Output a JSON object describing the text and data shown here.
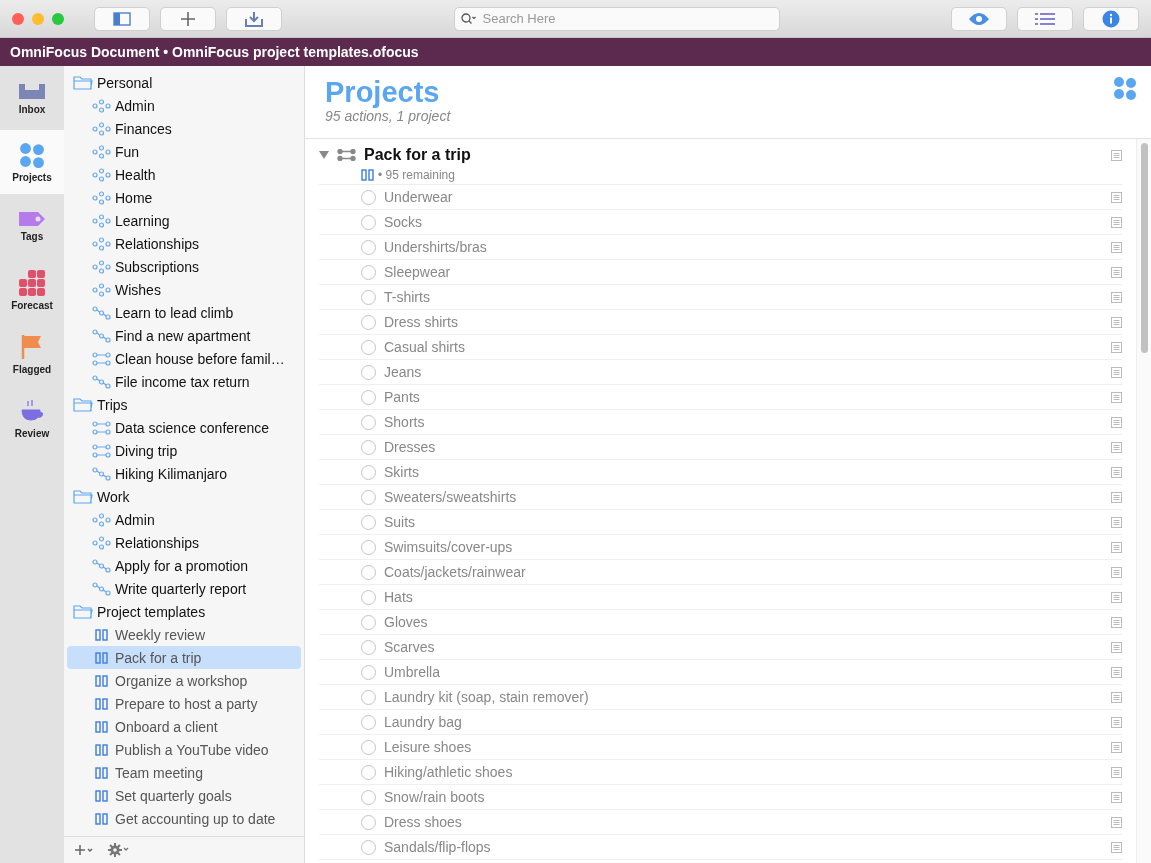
{
  "toolbar": {
    "search": {
      "placeholder": "Search Here"
    }
  },
  "title_bar": {
    "title": "OmniFocus Document • OmniFocus project templates.ofocus"
  },
  "perspectives": [
    {
      "label": "Inbox",
      "kind": "inbox",
      "selected": false
    },
    {
      "label": "Projects",
      "kind": "projects",
      "selected": true
    },
    {
      "label": "Tags",
      "kind": "tags",
      "selected": false
    },
    {
      "label": "Forecast",
      "kind": "forecast",
      "selected": false
    },
    {
      "label": "Flagged",
      "kind": "flagged",
      "selected": false
    },
    {
      "label": "Review",
      "kind": "review",
      "selected": false
    }
  ],
  "sidebar": {
    "folders": [
      {
        "label": "Personal",
        "children": [
          {
            "label": "Admin",
            "kind": "single",
            "selected": false
          },
          {
            "label": "Finances",
            "kind": "single",
            "selected": false
          },
          {
            "label": "Fun",
            "kind": "single",
            "selected": false
          },
          {
            "label": "Health",
            "kind": "single",
            "selected": false
          },
          {
            "label": "Home",
            "kind": "single",
            "selected": false
          },
          {
            "label": "Learning",
            "kind": "single",
            "selected": false
          },
          {
            "label": "Relationships",
            "kind": "single",
            "selected": false
          },
          {
            "label": "Subscriptions",
            "kind": "single",
            "selected": false
          },
          {
            "label": "Wishes",
            "kind": "single",
            "selected": false
          },
          {
            "label": "Learn to lead climb",
            "kind": "sequential",
            "selected": false
          },
          {
            "label": "Find a new apartment",
            "kind": "sequential",
            "selected": false
          },
          {
            "label": "Clean house before famil…",
            "kind": "parallel",
            "selected": false
          },
          {
            "label": "File income tax return",
            "kind": "sequential",
            "selected": false
          }
        ]
      },
      {
        "label": "Trips",
        "children": [
          {
            "label": "Data science conference",
            "kind": "parallel",
            "selected": false
          },
          {
            "label": "Diving trip",
            "kind": "parallel",
            "selected": false
          },
          {
            "label": "Hiking Kilimanjaro",
            "kind": "sequential",
            "selected": false
          }
        ]
      },
      {
        "label": "Work",
        "children": [
          {
            "label": "Admin",
            "kind": "single",
            "selected": false
          },
          {
            "label": "Relationships",
            "kind": "single",
            "selected": false
          },
          {
            "label": "Apply for a promotion",
            "kind": "sequential",
            "selected": false
          },
          {
            "label": "Write quarterly report",
            "kind": "sequential",
            "selected": false
          }
        ]
      },
      {
        "label": "Project templates",
        "children": [
          {
            "label": "Weekly review",
            "kind": "on_hold",
            "selected": false
          },
          {
            "label": "Pack for a trip",
            "kind": "on_hold",
            "selected": true
          },
          {
            "label": "Organize a workshop",
            "kind": "on_hold",
            "selected": false
          },
          {
            "label": "Prepare to host a party",
            "kind": "on_hold",
            "selected": false
          },
          {
            "label": "Onboard a client",
            "kind": "on_hold",
            "selected": false
          },
          {
            "label": "Publish a YouTube video",
            "kind": "on_hold",
            "selected": false
          },
          {
            "label": "Team meeting",
            "kind": "on_hold",
            "selected": false
          },
          {
            "label": "Set quarterly goals",
            "kind": "on_hold",
            "selected": false
          },
          {
            "label": "Get accounting up to date",
            "kind": "on_hold",
            "selected": false
          }
        ]
      }
    ]
  },
  "main": {
    "title": "Projects",
    "subtitle": "95 actions, 1 project",
    "project": {
      "title": "Pack for a trip",
      "expanded": true,
      "status": "• 95 remaining",
      "actions": [
        {
          "label": "Underwear",
          "checked": false
        },
        {
          "label": "Socks",
          "checked": false
        },
        {
          "label": "Undershirts/bras",
          "checked": false
        },
        {
          "label": "Sleepwear",
          "checked": false
        },
        {
          "label": "T-shirts",
          "checked": false
        },
        {
          "label": "Dress shirts",
          "checked": false
        },
        {
          "label": "Casual shirts",
          "checked": false
        },
        {
          "label": "Jeans",
          "checked": false
        },
        {
          "label": "Pants",
          "checked": false
        },
        {
          "label": "Shorts",
          "checked": false
        },
        {
          "label": "Dresses",
          "checked": false
        },
        {
          "label": "Skirts",
          "checked": false
        },
        {
          "label": "Sweaters/sweatshirts",
          "checked": false
        },
        {
          "label": "Suits",
          "checked": false
        },
        {
          "label": "Swimsuits/cover-ups",
          "checked": false
        },
        {
          "label": "Coats/jackets/rainwear",
          "checked": false
        },
        {
          "label": "Hats",
          "checked": false
        },
        {
          "label": "Gloves",
          "checked": false
        },
        {
          "label": "Scarves",
          "checked": false
        },
        {
          "label": "Umbrella",
          "checked": false
        },
        {
          "label": "Laundry kit (soap, stain remover)",
          "checked": false
        },
        {
          "label": "Laundry bag",
          "checked": false
        },
        {
          "label": "Leisure shoes",
          "checked": false
        },
        {
          "label": "Hiking/athletic shoes",
          "checked": false
        },
        {
          "label": "Snow/rain boots",
          "checked": false
        },
        {
          "label": "Dress shoes",
          "checked": false
        },
        {
          "label": "Sandals/flip-flops",
          "checked": false
        }
      ]
    }
  }
}
